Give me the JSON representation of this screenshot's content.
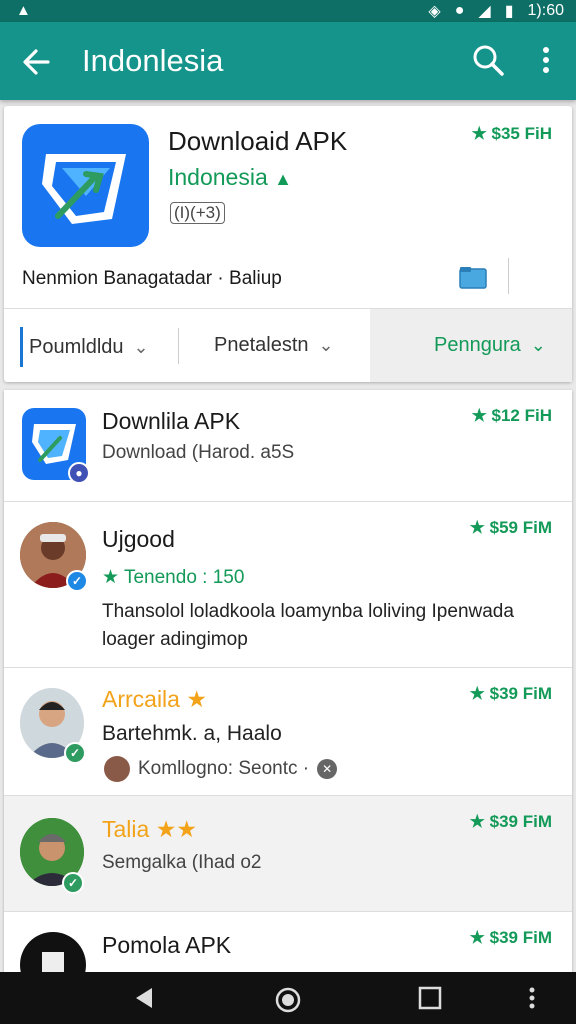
{
  "status_bar": {
    "time": "1):60"
  },
  "app_bar": {
    "title": "Indonlesia"
  },
  "header": {
    "title": "Downloaid APK",
    "subtitle": "Indonesia",
    "badge": "(I)(+3)",
    "price": "★ $35 FiH",
    "developer": "Nenmion Banagatadar · Baliup"
  },
  "filters": [
    {
      "label": "Poumldldu"
    },
    {
      "label": "Pnetalestn"
    },
    {
      "label": "Penngura"
    }
  ],
  "list": [
    {
      "title": "Downlila APK",
      "line2": "Download (Harod. a5S",
      "price": "★ $12 FiH"
    },
    {
      "title": "Ujgood",
      "rating": "Tenendo : 150",
      "price": "★ $59 FiM",
      "description": "Thansolol loladkoola loamynba loliving Ipenwada loager adingimop"
    },
    {
      "title": "Arrcaila",
      "line2": "Bartehmk. a, Haalo",
      "line3": "Komllogno: Seontc ·",
      "price": "★ $39 FiM"
    },
    {
      "title": "Talia",
      "line2": "Semgalka (Ihad o2",
      "price": "★ $39 FiM"
    },
    {
      "title": "Pomola APK",
      "price": "★ $39 FiM"
    }
  ],
  "colors": {
    "accent": "#14948a",
    "green": "#139a58",
    "star": "#f2a31a",
    "icon_blue": "#1976f0"
  }
}
